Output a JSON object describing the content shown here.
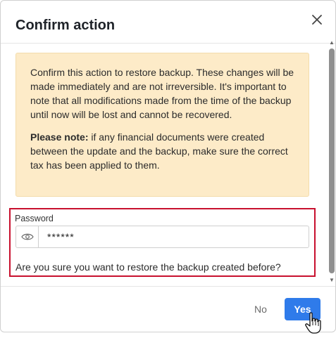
{
  "dialog": {
    "title": "Confirm action",
    "close_icon": "close-icon"
  },
  "notice": {
    "paragraph1": "Confirm this action to restore backup. These changes will be made immediately and are not irreversible. It's important to note that all modifications made from the time of the backup until now will be lost and cannot be recovered.",
    "note_label": "Please note:",
    "note_text": " if any financial documents were created between the update and the backup, make sure the correct tax has been applied to them.",
    "background": "#fdebc8"
  },
  "password": {
    "label": "Password",
    "value": "******",
    "toggle_icon": "eye-icon"
  },
  "question": "Are you sure you want to restore the backup created before?",
  "buttons": {
    "no": "No",
    "yes": "Yes"
  },
  "colors": {
    "accent": "#2f7bea",
    "highlight_border": "#c8102e"
  }
}
